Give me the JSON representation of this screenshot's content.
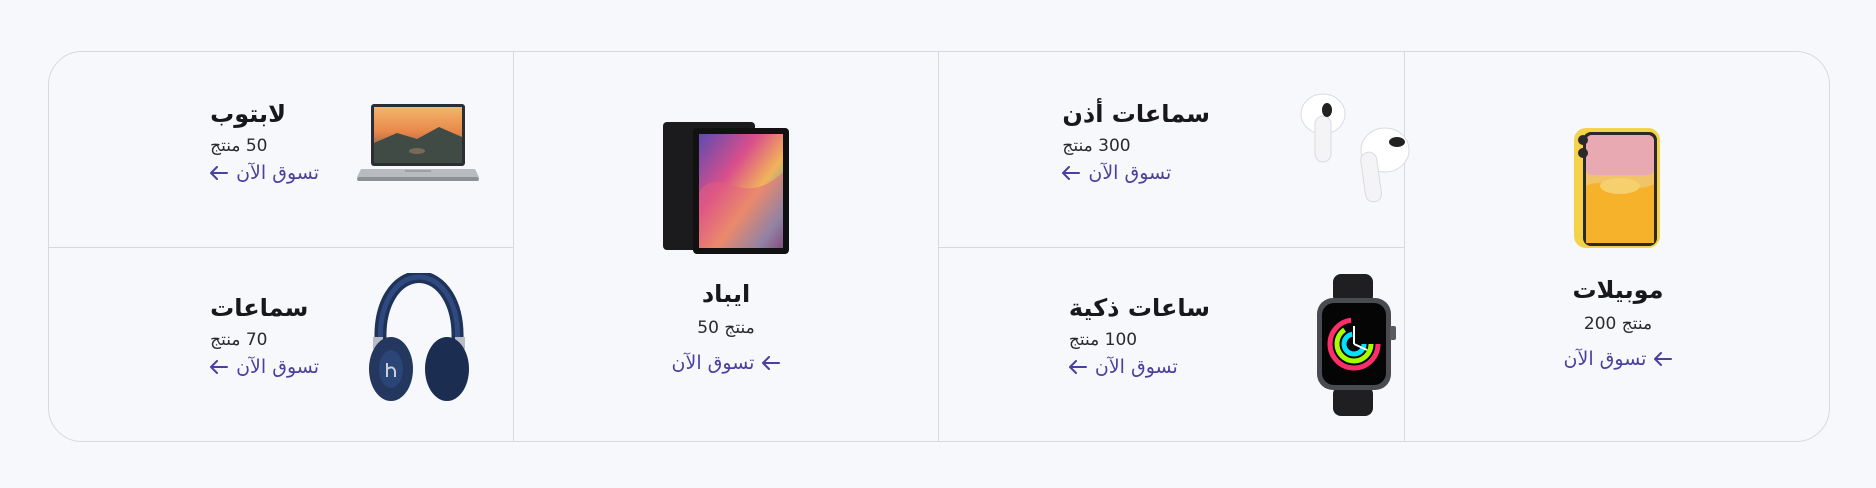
{
  "categories": {
    "laptop": {
      "title": "لابتوب",
      "count": "50 منتج",
      "shop_label": "تسوق الآن",
      "image_alt": "laptop-image"
    },
    "headphones": {
      "title": "سماعات",
      "count": "70 منتج",
      "shop_label": "تسوق الآن",
      "image_alt": "headphones-image"
    },
    "ipad": {
      "title": "ايباد",
      "count": "50 منتج",
      "shop_label": "تسوق الآن",
      "image_alt": "tablet-image"
    },
    "earphones": {
      "title": "سماعات أذن",
      "count": "300 منتج",
      "shop_label": "تسوق الآن",
      "image_alt": "earbuds-image"
    },
    "smartwatch": {
      "title": "ساعات ذكية",
      "count": "100 منتج",
      "shop_label": "تسوق الآن",
      "image_alt": "smartwatch-image"
    },
    "mobiles": {
      "title": "موبيلات",
      "count": "200 منتج",
      "shop_label": "تسوق الآن",
      "image_alt": "phone-image"
    }
  },
  "colors": {
    "accent": "#4b3fa0",
    "border": "#d7d9de",
    "background": "#f7f8fb"
  }
}
